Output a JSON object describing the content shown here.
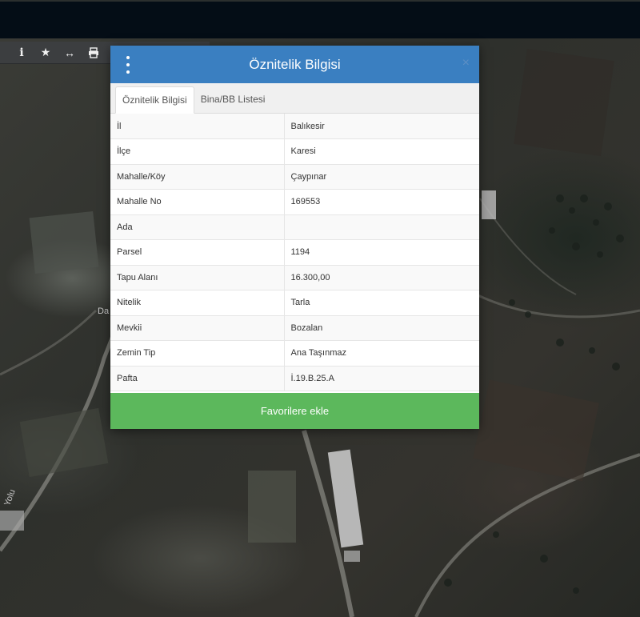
{
  "toolbar": {
    "items": [
      {
        "name": "info-icon",
        "glyph": "i"
      },
      {
        "name": "star-icon",
        "glyph": "★"
      },
      {
        "name": "measure-icon",
        "glyph": "↔"
      },
      {
        "name": "print-icon",
        "glyph": ""
      }
    ]
  },
  "map": {
    "labels": [
      "Da",
      "Yolu"
    ]
  },
  "modal": {
    "title": "Öznitelik Bilgisi",
    "close_label": "×",
    "tabs": [
      {
        "label": "Öznitelik Bilgisi",
        "active": true
      },
      {
        "label": "Bina/BB Listesi",
        "active": false
      }
    ],
    "rows": [
      {
        "key": "İl",
        "value": "Balıkesir"
      },
      {
        "key": "İlçe",
        "value": "Karesi"
      },
      {
        "key": "Mahalle/Köy",
        "value": "Çaypınar"
      },
      {
        "key": "Mahalle No",
        "value": "169553"
      },
      {
        "key": "Ada",
        "value": ""
      },
      {
        "key": "Parsel",
        "value": "1194"
      },
      {
        "key": "Tapu Alanı",
        "value": "16.300,00"
      },
      {
        "key": "Nitelik",
        "value": "Tarla"
      },
      {
        "key": "Mevkii",
        "value": "Bozalan"
      },
      {
        "key": "Zemin Tip",
        "value": "Ana Taşınmaz"
      },
      {
        "key": "Pafta",
        "value": "İ.19.B.25.A"
      }
    ],
    "favorite_label": "Favorilere ekle"
  },
  "colors": {
    "header": "#3a7fc1",
    "favorite": "#5cb85c",
    "topbar": "#040d16"
  }
}
